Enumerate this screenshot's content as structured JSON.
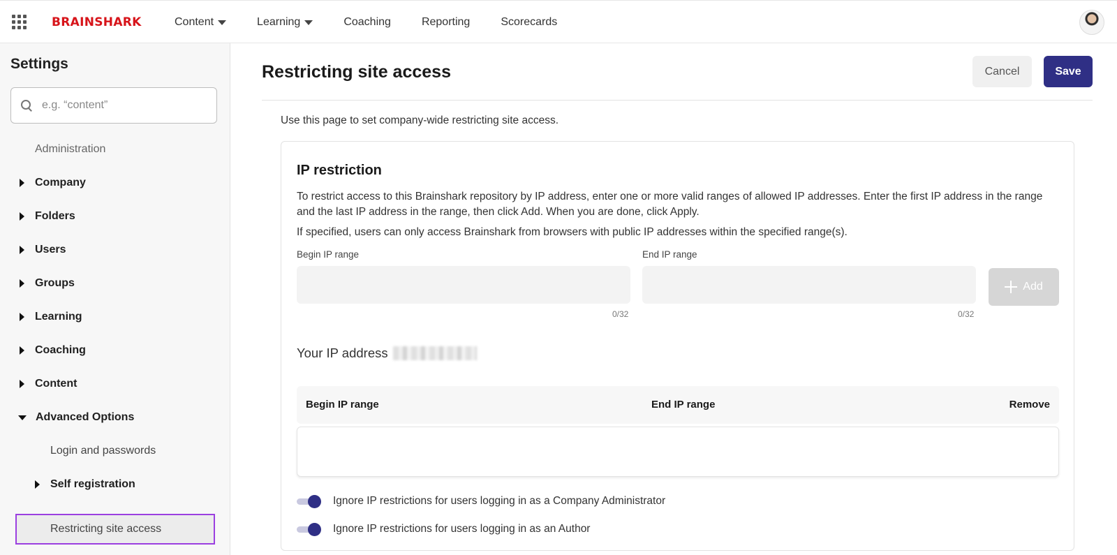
{
  "header": {
    "logo": "BRAINSHARK",
    "nav": [
      {
        "label": "Content",
        "dropdown": true
      },
      {
        "label": "Learning",
        "dropdown": true
      },
      {
        "label": "Coaching",
        "dropdown": false
      },
      {
        "label": "Reporting",
        "dropdown": false
      },
      {
        "label": "Scorecards",
        "dropdown": false
      }
    ]
  },
  "sidebar": {
    "title": "Settings",
    "search_placeholder": "e.g. “content”",
    "items": [
      {
        "label": "Administration",
        "type": "section"
      },
      {
        "label": "Company",
        "type": "collapsed"
      },
      {
        "label": "Folders",
        "type": "collapsed"
      },
      {
        "label": "Users",
        "type": "collapsed"
      },
      {
        "label": "Groups",
        "type": "collapsed"
      },
      {
        "label": "Learning",
        "type": "collapsed"
      },
      {
        "label": "Coaching",
        "type": "collapsed"
      },
      {
        "label": "Content",
        "type": "collapsed"
      },
      {
        "label": "Advanced Options",
        "type": "expanded"
      },
      {
        "label": "Login and passwords",
        "type": "child"
      },
      {
        "label": "Self registration",
        "type": "child-collapsed"
      },
      {
        "label": "Restricting site access",
        "type": "child-selected"
      }
    ]
  },
  "main": {
    "title": "Restricting site access",
    "cancel_label": "Cancel",
    "save_label": "Save",
    "intro": "Use this page to set company-wide restricting site access.",
    "card": {
      "title": "IP restriction",
      "desc1": "To restrict access to this Brainshark repository by IP address, enter one or more valid ranges of allowed IP addresses. Enter the first IP address in the range and the last IP address in the range, then click Add. When you are done, click Apply.",
      "desc2": "If specified, users can only access Brainshark from browsers with public IP addresses within the specified range(s).",
      "begin_label": "Begin IP range",
      "end_label": "End IP range",
      "begin_counter": "0/32",
      "end_counter": "0/32",
      "add_label": "Add",
      "your_ip_label": "Your IP address",
      "table_headers": {
        "begin": "Begin IP range",
        "end": "End IP range",
        "remove": "Remove"
      },
      "toggles": [
        {
          "label": "Ignore IP restrictions for users logging in as a Company Administrator",
          "on": true
        },
        {
          "label": "Ignore IP restrictions for users logging in as an Author",
          "on": true
        }
      ]
    }
  },
  "colors": {
    "brand": "#d7141a",
    "primary": "#2f2f85",
    "selection_outline": "#9b3fe0"
  }
}
